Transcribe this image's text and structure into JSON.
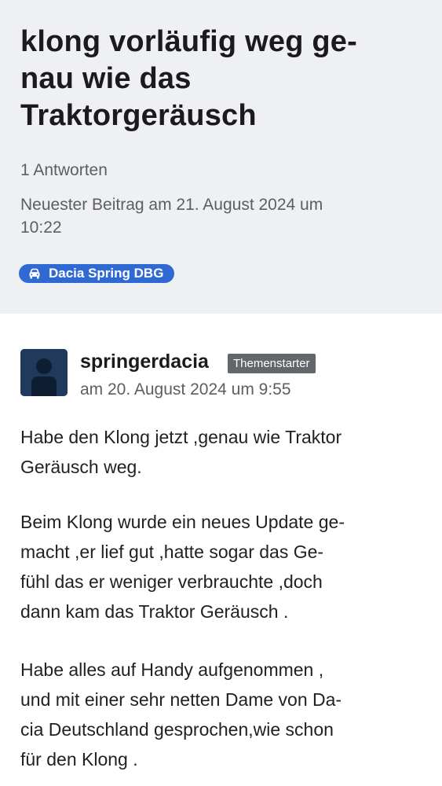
{
  "topic": {
    "title_lines": [
      "klong vorläufig weg ge-",
      "nau wie das",
      "Traktorgeräusch"
    ],
    "replies": "1 Antworten",
    "latest_lines": [
      "Neuester Beitrag am 21. August 2024 um",
      "10:22"
    ],
    "tag": {
      "icon": "car-icon",
      "label": "Dacia Spring DBG",
      "color": "#2f6ad4"
    }
  },
  "post": {
    "author": "springerdacia",
    "badge": "Themenstarter",
    "date": "am 20. August 2024 um 9:55",
    "avatar_icon": "user-silhouette-icon",
    "paragraphs": [
      [
        "Habe den Klong jetzt ,genau wie Traktor",
        "Geräusch weg."
      ],
      [
        "Beim Klong wurde ein neues Update ge-",
        "macht ,er lief gut ,hatte sogar das Ge-",
        "fühl das er weniger verbrauchte ,doch",
        "dann kam das Traktor Geräusch ."
      ],
      [
        "Habe alles auf Handy aufgenommen ,",
        "und mit einer sehr netten Dame von Da-",
        "cia Deutschland gesprochen,wie schon",
        "für den Klong ."
      ]
    ]
  }
}
